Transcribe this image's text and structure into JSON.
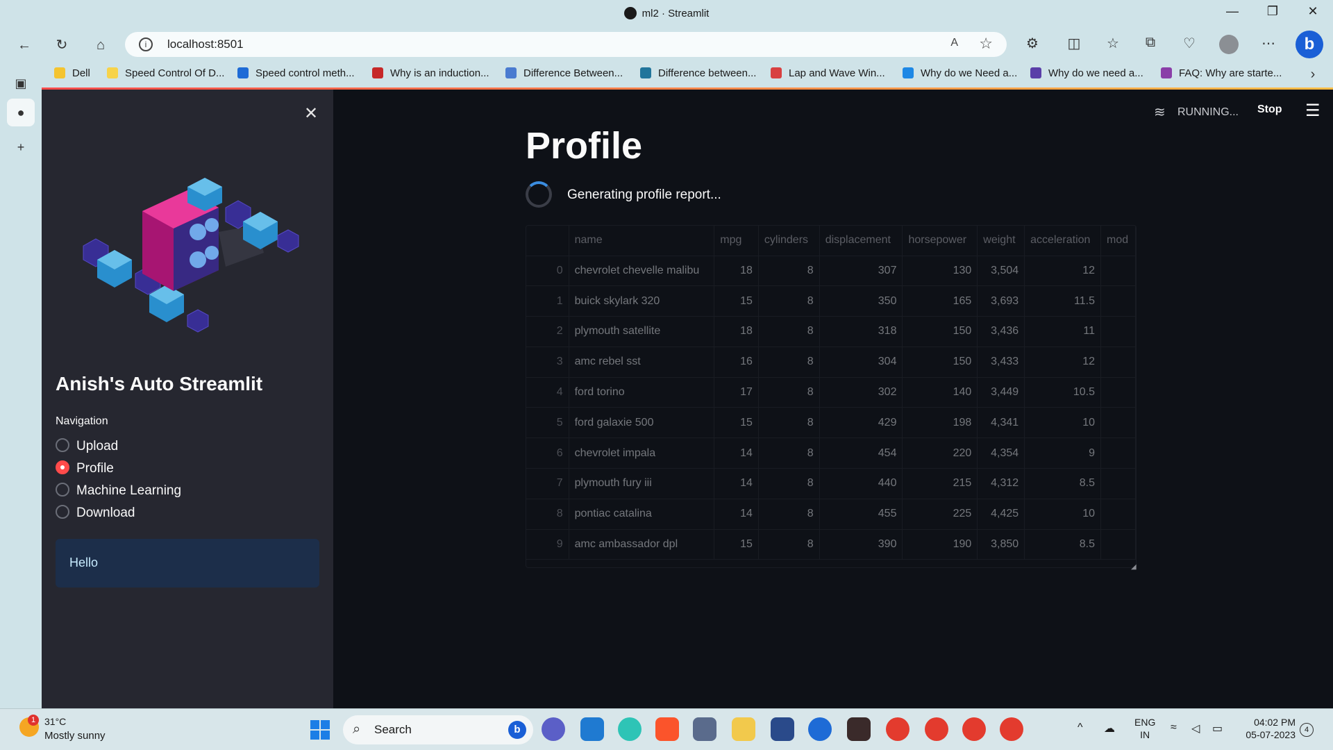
{
  "window": {
    "title": "ml2 · Streamlit",
    "min": "—",
    "max": "❐",
    "close": "✕"
  },
  "browser": {
    "url": "localhost:8501",
    "bookmarks": [
      {
        "label": "Dell",
        "color": "#f4c430"
      },
      {
        "label": "Speed Control Of D...",
        "color": "#f7d34a"
      },
      {
        "label": "Speed control meth...",
        "color": "#1e6bd6"
      },
      {
        "label": "Why is an induction...",
        "color": "#c62828"
      },
      {
        "label": "Difference Between...",
        "color": "#4a7bd0"
      },
      {
        "label": "Difference between...",
        "color": "#21759b"
      },
      {
        "label": "Lap and Wave Win...",
        "color": "#d84040"
      },
      {
        "label": "Why do we Need a...",
        "color": "#1e88e5"
      },
      {
        "label": "Why do we need a...",
        "color": "#5a3ea8"
      },
      {
        "label": "FAQ: Why are starte...",
        "color": "#8a3ea8"
      }
    ]
  },
  "sidebar": {
    "title": "Anish's Auto Streamlit",
    "nav_label": "Navigation",
    "nav_items": [
      "Upload",
      "Profile",
      "Machine Learning",
      "Download"
    ],
    "selected": "Profile",
    "info": "Hello"
  },
  "status": {
    "running": "RUNNING...",
    "stop": "Stop"
  },
  "main": {
    "title": "Profile",
    "loading": "Generating profile report...",
    "table": {
      "columns": [
        "",
        "name",
        "mpg",
        "cylinders",
        "displacement",
        "horsepower",
        "weight",
        "acceleration",
        "mod"
      ],
      "rows": [
        [
          "0",
          "chevrolet chevelle malibu",
          "18",
          "8",
          "307",
          "130",
          "3,504",
          "12",
          ""
        ],
        [
          "1",
          "buick skylark 320",
          "15",
          "8",
          "350",
          "165",
          "3,693",
          "11.5",
          ""
        ],
        [
          "2",
          "plymouth satellite",
          "18",
          "8",
          "318",
          "150",
          "3,436",
          "11",
          ""
        ],
        [
          "3",
          "amc rebel sst",
          "16",
          "8",
          "304",
          "150",
          "3,433",
          "12",
          ""
        ],
        [
          "4",
          "ford torino",
          "17",
          "8",
          "302",
          "140",
          "3,449",
          "10.5",
          ""
        ],
        [
          "5",
          "ford galaxie 500",
          "15",
          "8",
          "429",
          "198",
          "4,341",
          "10",
          ""
        ],
        [
          "6",
          "chevrolet impala",
          "14",
          "8",
          "454",
          "220",
          "4,354",
          "9",
          ""
        ],
        [
          "7",
          "plymouth fury iii",
          "14",
          "8",
          "440",
          "215",
          "4,312",
          "8.5",
          ""
        ],
        [
          "8",
          "pontiac catalina",
          "14",
          "8",
          "455",
          "225",
          "4,425",
          "10",
          ""
        ],
        [
          "9",
          "amc ambassador dpl",
          "15",
          "8",
          "390",
          "190",
          "3,850",
          "8.5",
          ""
        ]
      ]
    }
  },
  "taskbar": {
    "weather_temp": "31°C",
    "weather_desc": "Mostly sunny",
    "weather_badge": "1",
    "search": "Search",
    "lang1": "ENG",
    "lang2": "IN",
    "time": "04:02 PM",
    "date": "05-07-2023",
    "notifications": "4"
  }
}
